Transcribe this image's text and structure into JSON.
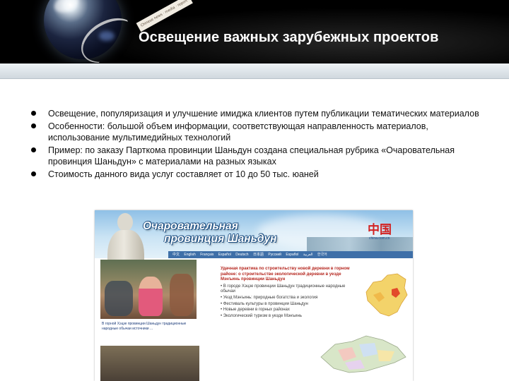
{
  "slide": {
    "title": "Освещение важных зарубежных проектов",
    "paper_text": "Chinese news · media · report",
    "bullets": [
      "Освещение, популяризация и улучшение имиджа клиентов путем публикации тематических материалов",
      "Особенности: большой объем информации, соответствующая направленность материалов, использование мультимедийных технологий",
      "Пример: по заказу Парткома провинции Шаньдун  создана специальная рубрика «Очаровательная провинция Шаньдун» с материалами на разных языках",
      "Стоимость данного вида услуг составляет от 10 до 50 тыс. юаней"
    ]
  },
  "screenshot": {
    "banner_line1": "Очаровательная",
    "banner_line2": "провинция Шаньдун",
    "logo_cn": "中国",
    "logo_url": "china.com.cn",
    "nav": [
      "中文",
      "English",
      "Français",
      "Español",
      "Deutsch",
      "日本語",
      "Русский",
      "Español",
      "العربية",
      "한국어"
    ],
    "photo_caption": "В горной Хэцзе провинции Шаньдун традиционные народные обычаи источники ...",
    "article_title": "Удачная практика по строительству новой деревни в горном районе: о строительстве экологической деревни в уезде Мэнъинь провинции Шаньдун",
    "article_items": [
      "• В городе Хэцзе провинции Шаньдун традиционные народные обычаи",
      "• Уезд Мэнъинь: природные богатства и экология",
      "• Фестиваль культуры в провинции Шаньдун",
      "• Новые деревни в горных районах",
      "• Экологический туризм в уезде Мэнъинь"
    ]
  },
  "colors": {
    "header_bg": "#000000",
    "title_text": "#ffffff",
    "band": "#dce3e8",
    "banner_title": "#ffffff",
    "article_title": "#b5261e",
    "nav_bg": "#3e6fa8",
    "logo_red": "#d22222"
  }
}
